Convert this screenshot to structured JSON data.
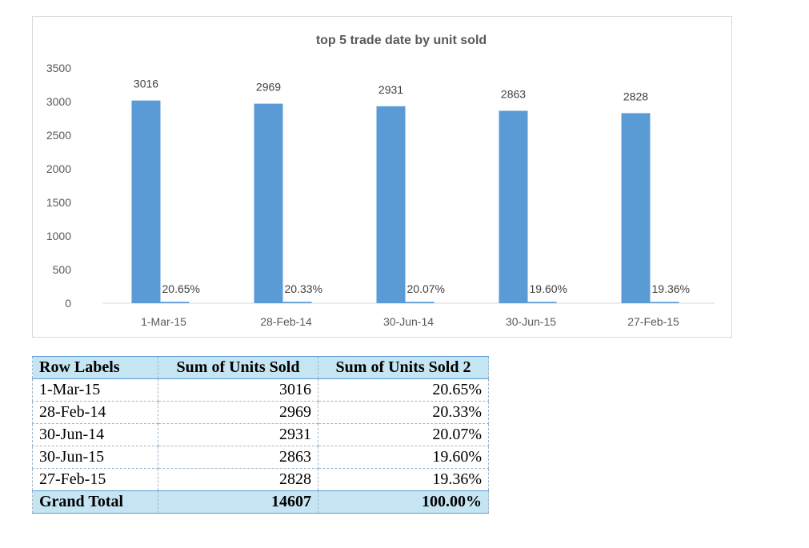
{
  "chart_data": {
    "type": "bar",
    "title": "top 5 trade date by unit sold",
    "xlabel": "",
    "ylabel": "",
    "categories": [
      "1-Mar-15",
      "28-Feb-14",
      "30-Jun-14",
      "30-Jun-15",
      "27-Feb-15"
    ],
    "series": [
      {
        "values": [
          3016,
          2969,
          2931,
          2863,
          2828
        ],
        "color": "#5b9bd5",
        "labels": [
          "3016",
          "2969",
          "2931",
          "2863",
          "2828"
        ]
      },
      {
        "values": [
          20.65,
          20.33,
          20.07,
          19.6,
          19.36
        ],
        "color": "#5b9bd5",
        "labels": [
          "20.65%",
          "20.33%",
          "20.07%",
          "19.60%",
          "19.36%"
        ]
      }
    ],
    "ylim": [
      0,
      3500
    ],
    "yticks": [
      0,
      500,
      1000,
      1500,
      2000,
      2500,
      3000,
      3500
    ],
    "grid": false,
    "legend": "none"
  },
  "table": {
    "headers": [
      "Row Labels",
      "Sum of Units Sold",
      "Sum of Units Sold 2"
    ],
    "rows": [
      [
        "1-Mar-15",
        "3016",
        "20.65%"
      ],
      [
        "28-Feb-14",
        "2969",
        "20.33%"
      ],
      [
        "30-Jun-14",
        "2931",
        "20.07%"
      ],
      [
        "30-Jun-15",
        "2863",
        "19.60%"
      ],
      [
        "27-Feb-15",
        "2828",
        "19.36%"
      ]
    ],
    "total": [
      "Grand Total",
      "14607",
      "100.00%"
    ]
  },
  "colors": {
    "bar": "#5b9bd5",
    "header_fill": "#c5e5f3",
    "header_border": "#5b9bd5",
    "axis_text": "#595959"
  }
}
